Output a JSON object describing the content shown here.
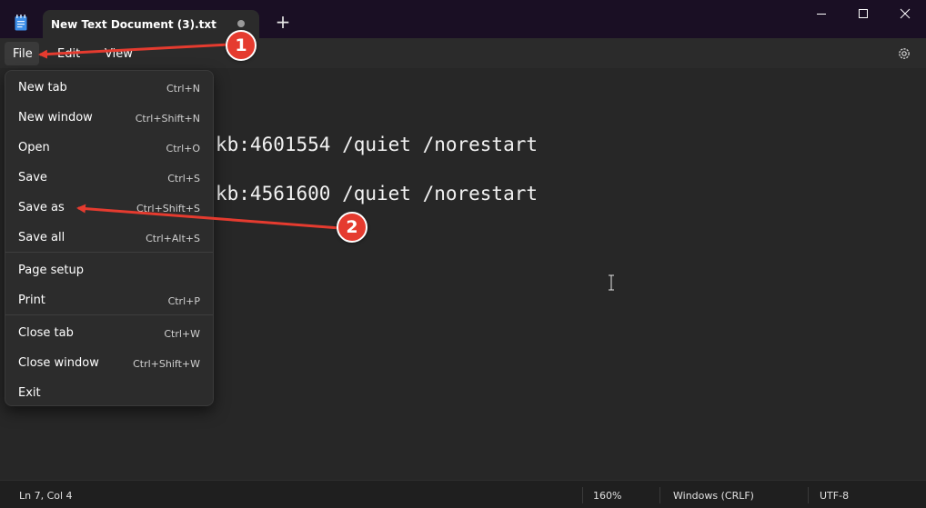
{
  "window": {
    "tab_title": "New Text Document (3).txt",
    "new_tab_symbol": "+"
  },
  "icons": {
    "app": "notepad-icon",
    "unsaved": "unsaved-dot-icon",
    "minimize": "minimize-icon",
    "maximize": "maximize-icon",
    "close": "close-icon",
    "settings": "gear-icon",
    "cursor": "text-cursor-icon"
  },
  "menubar": {
    "file": "File",
    "edit": "Edit",
    "view": "View"
  },
  "editor": {
    "lines": [
      "kb:4601554 /quiet /norestart",
      "kb:4561600 /quiet /norestart"
    ]
  },
  "file_menu": {
    "items": [
      {
        "label": "New tab",
        "shortcut": "Ctrl+N"
      },
      {
        "label": "New window",
        "shortcut": "Ctrl+Shift+N"
      },
      {
        "label": "Open",
        "shortcut": "Ctrl+O"
      },
      {
        "label": "Save",
        "shortcut": "Ctrl+S"
      },
      {
        "label": "Save as",
        "shortcut": "Ctrl+Shift+S"
      },
      {
        "label": "Save all",
        "shortcut": "Ctrl+Alt+S"
      },
      {
        "label": "Page setup",
        "shortcut": ""
      },
      {
        "label": "Print",
        "shortcut": "Ctrl+P"
      },
      {
        "label": "Close tab",
        "shortcut": "Ctrl+W"
      },
      {
        "label": "Close window",
        "shortcut": "Ctrl+Shift+W"
      },
      {
        "label": "Exit",
        "shortcut": ""
      }
    ]
  },
  "statusbar": {
    "position": "Ln 7, Col 4",
    "zoom": "160%",
    "line_ending": "Windows (CRLF)",
    "encoding": "UTF-8"
  },
  "annotations": {
    "step1": "1",
    "step2": "2",
    "color": "#e53b2f"
  },
  "colors": {
    "titlebar": "#1a0f24",
    "menubar": "#2b2b2b",
    "editor": "#272727",
    "menu_bg": "#2c2c2c"
  }
}
